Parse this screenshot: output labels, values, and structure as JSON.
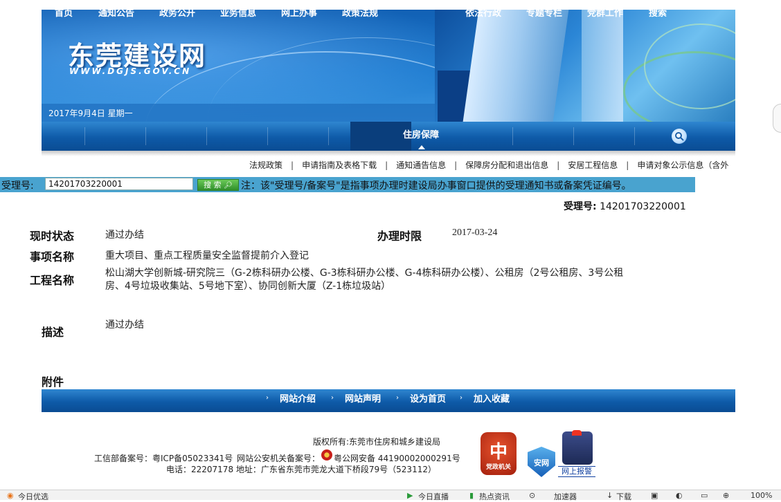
{
  "header": {
    "site_title": "东莞建设网",
    "site_url": "WWW.DGJS.GOV.CN",
    "date": "2017年9月4日  星期一"
  },
  "nav": {
    "items": [
      "首页",
      "通知公告",
      "政务公开",
      "业务信息",
      "网上办事",
      "政策法规",
      "住房保障",
      "依法行政",
      "专题专栏",
      "党群工作",
      "搜索"
    ],
    "active": "住房保障"
  },
  "subnav": {
    "items": [
      "法规政策",
      "申请指南及表格下载",
      "通知通告信息",
      "保障房分配和退出信息",
      "安居工程信息",
      "申请对象公示信息（含外"
    ]
  },
  "search": {
    "label": "受理号:",
    "value": "14201703220001",
    "button_label": "搜 索",
    "note": "注：该\"受理号/备案号\"是指事项办理时建设局办事窗口提供的受理通知书或备案凭证编号。"
  },
  "detail": {
    "acceptance_label": "受理号:",
    "acceptance_value": "14201703220001",
    "status_label": "现时状态",
    "status_value": "通过办结",
    "deadline_label": "办理时限",
    "deadline_value": "2017-03-24",
    "item_label": "事项名称",
    "item_value": "重大项目、重点工程质量安全监督提前介入登记",
    "project_label": "工程名称",
    "project_value_line1": "松山湖大学创新城-研究院三（G-2栋科研办公楼、G-3栋科研办公楼、G-4栋科研办公楼）、公租房（2号公租房、3号公租",
    "project_value_line2": "房、4号垃圾收集站、5号地下室）、协同创新大厦（Z-1栋垃圾站）",
    "desc_label": "描述",
    "desc_value": "通过办结",
    "attach_label": "附件"
  },
  "footer": {
    "links": [
      "网站介绍",
      "网站声明",
      "设为首页",
      "加入收藏"
    ],
    "copyright": "版权所有:东莞市住房和城乡建设局",
    "icp": "工信部备案号：粤ICP备05023341号",
    "police_label": "网站公安机关备案号：",
    "police_value": "粤公网安备 44190002000291号",
    "contact": "电话：22207178     地址：广东省东莞市莞龙大道下桥段79号（523112）",
    "badge1": "党政机关",
    "badge2": "安网",
    "badge3": "网上报警"
  },
  "statusbar": {
    "items": [
      "今日优选",
      "今日直播",
      "热点资讯",
      "加速器",
      "下载",
      "100%"
    ]
  }
}
